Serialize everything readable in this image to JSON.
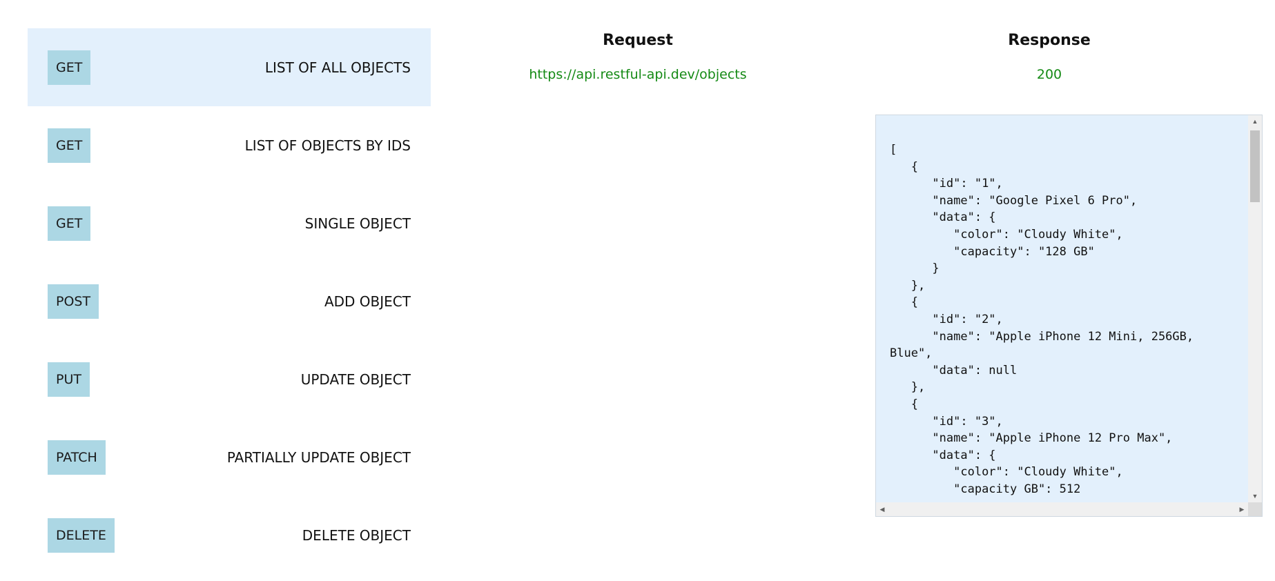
{
  "endpoints": [
    {
      "method": "GET",
      "label": "LIST OF ALL OBJECTS",
      "selected": true
    },
    {
      "method": "GET",
      "label": "LIST OF OBJECTS BY IDS",
      "selected": false
    },
    {
      "method": "GET",
      "label": "SINGLE OBJECT",
      "selected": false
    },
    {
      "method": "POST",
      "label": "ADD OBJECT",
      "selected": false
    },
    {
      "method": "PUT",
      "label": "UPDATE OBJECT",
      "selected": false
    },
    {
      "method": "PATCH",
      "label": "PARTIALLY UPDATE OBJECT",
      "selected": false
    },
    {
      "method": "DELETE",
      "label": "DELETE OBJECT",
      "selected": false
    }
  ],
  "request": {
    "heading": "Request",
    "url": "https://api.restful-api.dev/objects"
  },
  "response": {
    "heading": "Response",
    "status": "200",
    "body": "[\n   {\n      \"id\": \"1\",\n      \"name\": \"Google Pixel 6 Pro\",\n      \"data\": {\n         \"color\": \"Cloudy White\",\n         \"capacity\": \"128 GB\"\n      }\n   },\n   {\n      \"id\": \"2\",\n      \"name\": \"Apple iPhone 12 Mini, 256GB, Blue\",\n      \"data\": null\n   },\n   {\n      \"id\": \"3\",\n      \"name\": \"Apple iPhone 12 Pro Max\",\n      \"data\": {\n         \"color\": \"Cloudy White\",\n         \"capacity GB\": 512"
  },
  "colors": {
    "selected_row_bg": "#e3f0fc",
    "method_badge_bg": "#acd7e4",
    "green_text": "#158a15",
    "response_bg": "#e3f0fc"
  },
  "icons": {
    "scroll_up": "scroll-up-arrow-icon",
    "scroll_down": "scroll-down-arrow-icon",
    "scroll_left": "scroll-left-arrow-icon",
    "scroll_right": "scroll-right-arrow-icon"
  }
}
